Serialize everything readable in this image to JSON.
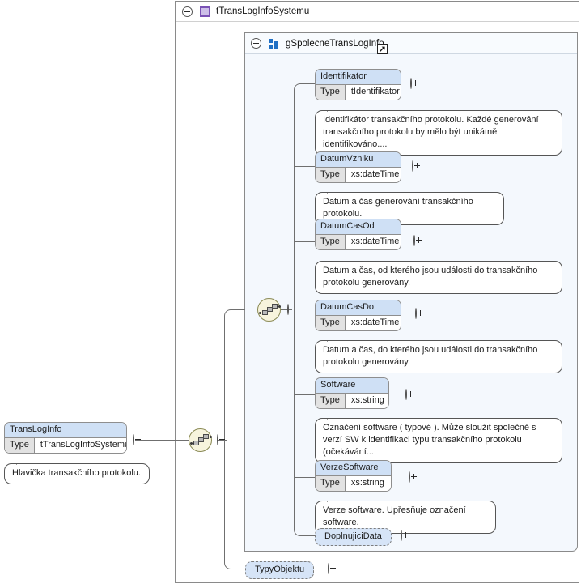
{
  "diagram": {
    "kind": "xsd-schema-diagram",
    "type_panel": {
      "icon": "complex-type-icon",
      "title": "tTransLogInfoSystemu",
      "expander": "minus"
    },
    "group_panel": {
      "icon": "model-group-icon",
      "title": "gSpolecneTransLogInfo",
      "link_icon": "external-link-icon",
      "expander": "minus"
    },
    "root_element": {
      "name": "TransLogInfo",
      "type_key": "Type",
      "type_value": "tTransLogInfoSystemu",
      "expander": "minus",
      "annotation": "Hlavička transakčního protokolu."
    },
    "compositors": [
      {
        "name": "outer-sequence",
        "icon": "sequence-icon",
        "expander": "minus"
      },
      {
        "name": "group-sequence",
        "icon": "sequence-icon",
        "expander": "minus"
      }
    ],
    "elements": [
      {
        "name": "Identifikator",
        "type_key": "Type",
        "type_value": "tIdentifikator",
        "expander": "plus",
        "annotation": "Identifikátor transakčního protokolu. Každé generování transakčního protokolu by mělo být unikátně identifikováno...."
      },
      {
        "name": "DatumVzniku",
        "type_key": "Type",
        "type_value": "xs:dateTime",
        "expander": "plus",
        "annotation": "Datum a čas generování transakčního protokolu."
      },
      {
        "name": "DatumCasOd",
        "type_key": "Type",
        "type_value": "xs:dateTime",
        "expander": "plus",
        "annotation": "Datum a čas, od kterého jsou události do transakčního protokolu generovány."
      },
      {
        "name": "DatumCasDo",
        "type_key": "Type",
        "type_value": "xs:dateTime",
        "expander": "plus",
        "annotation": "Datum a čas, do kterého jsou události do transakčního protokolu generovány."
      },
      {
        "name": "Software",
        "type_key": "Type",
        "type_value": "xs:string",
        "expander": "plus",
        "annotation": "Označení software ( typové ). Může sloužit společně s verzí SW k identifikaci typu transakčního protokolu (očekávání..."
      },
      {
        "name": "VerzeSoftware",
        "type_key": "Type",
        "type_value": "xs:string",
        "expander": "plus",
        "annotation": "Verze software. Upřesňuje označení software."
      }
    ],
    "ref_elements": [
      {
        "name": "DoplnujiciData",
        "expander": "plus"
      },
      {
        "name": "TypyObjektu",
        "expander": "plus"
      }
    ],
    "colors": {
      "element_header": "#cfe0f5",
      "type_cell": "#e2e2e2",
      "group_panel_bg": "#f4f8fd",
      "compositor_bg": "#f7f4dd",
      "group_icon": "#1f6fc4",
      "type_icon_border": "#7a52b5",
      "connector": "#6f6f6f"
    }
  }
}
